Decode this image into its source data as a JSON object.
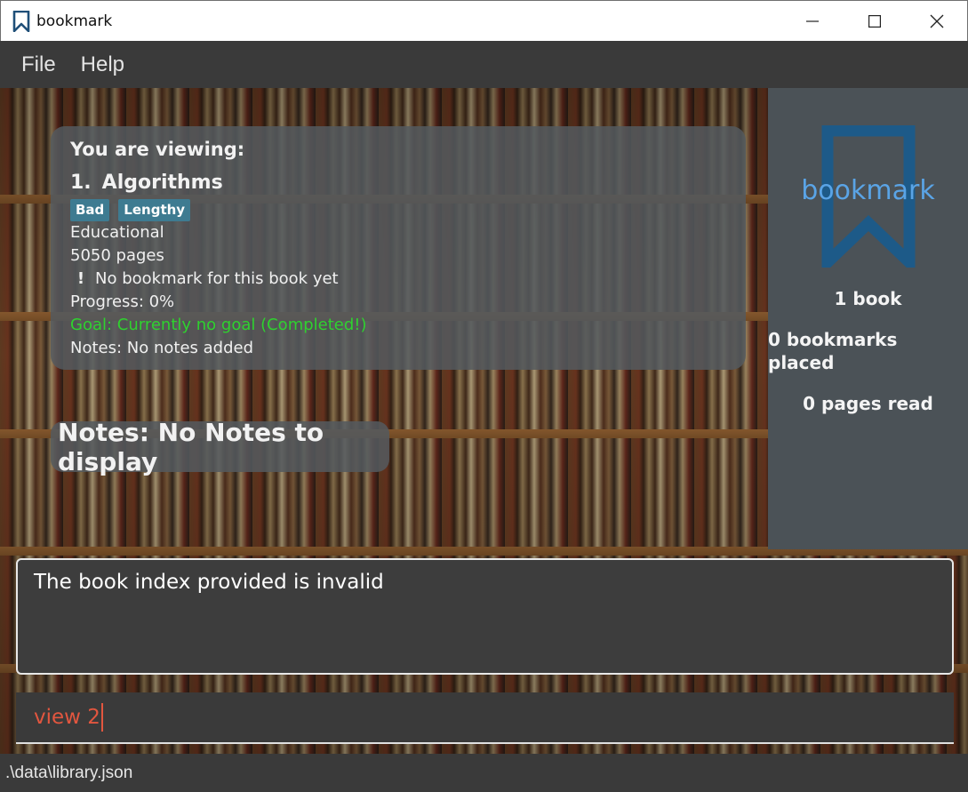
{
  "window": {
    "title": "bookmark",
    "icon": "bookmark-icon",
    "controls": [
      "minimize-icon",
      "maximize-icon",
      "close-icon"
    ]
  },
  "menu": {
    "items": [
      {
        "label": "File"
      },
      {
        "label": "Help"
      }
    ]
  },
  "viewing": {
    "heading": "You are viewing:",
    "index": "1.",
    "title": "Algorithms",
    "tags": [
      "Bad",
      "Lengthy"
    ],
    "genre": "Educational",
    "pages": "5050 pages",
    "bookmark_icon": "exclamation-icon",
    "bookmark_glyph": "!",
    "bookmark_status": "No bookmark for this book yet",
    "progress": "Progress: 0%",
    "goal": "Goal: Currently no goal (Completed!)",
    "notes": "Notes: No notes added"
  },
  "notes_panel": {
    "label": "Notes: No Notes to display"
  },
  "summary": {
    "logo_text": "bookmark",
    "books": "1 book",
    "bookmarks": "0 bookmarks placed",
    "pages_read": "0 pages read"
  },
  "result": {
    "message": "The book index provided is invalid"
  },
  "command": {
    "value": "view 2"
  },
  "status": {
    "file_path": ".\\data\\library.json"
  },
  "colors": {
    "accent": "#5aa4e6",
    "tag_bg": "#3e7b91",
    "goal_text": "#2fd12f",
    "command_text": "#e2563f"
  }
}
